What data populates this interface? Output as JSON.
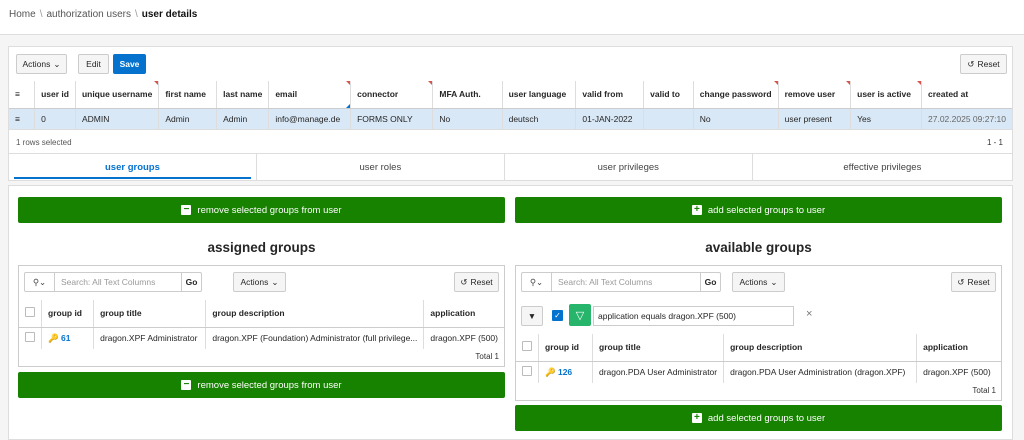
{
  "breadcrumb": {
    "home": "Home",
    "sep": "\\",
    "level2": "authorization users",
    "current": "user details"
  },
  "toolbar": {
    "actions": "Actions",
    "edit": "Edit",
    "save": "Save",
    "reset": "Reset"
  },
  "user_grid": {
    "columns": [
      "user id",
      "unique username",
      "first name",
      "last name",
      "email",
      "connector",
      "MFA Auth.",
      "user language",
      "valid from",
      "valid to",
      "change password",
      "remove user",
      "user is active",
      "created at"
    ],
    "row": [
      "0",
      "ADMIN",
      "Admin",
      "Admin",
      "info@manage.de",
      "FORMS ONLY",
      "No",
      "deutsch",
      "01-JAN-2022",
      "",
      "No",
      "user present",
      "Yes",
      "27.02.2025 09:27:10"
    ],
    "selected_text": "1 rows selected",
    "pagination": "1 - 1"
  },
  "tabs": [
    "user groups",
    "user roles",
    "user privileges",
    "effective privileges"
  ],
  "left": {
    "button": "remove selected groups from user",
    "title": "assigned groups",
    "search_placeholder": "Search: All Text Columns",
    "go": "Go",
    "actions": "Actions",
    "reset": "Reset",
    "columns": [
      "group id",
      "group title",
      "group description",
      "application"
    ],
    "row": {
      "id": "61",
      "title": "dragon.XPF Administrator",
      "desc": "dragon.XPF (Foundation) Administrator (full privilege...",
      "app": "dragon.XPF (500)"
    },
    "total": "Total 1"
  },
  "right": {
    "button": "add selected groups to user",
    "title": "available groups",
    "search_placeholder": "Search: All Text Columns",
    "go": "Go",
    "actions": "Actions",
    "reset": "Reset",
    "filter": "application equals dragon.XPF (500)",
    "columns": [
      "group id",
      "group title",
      "group description",
      "application"
    ],
    "row": {
      "id": "126",
      "title": "dragon.PDA User Administrator",
      "desc": "dragon.PDA User Administration (dragon.XPF)",
      "app": "dragon.XPF (500)"
    },
    "total": "Total 1"
  },
  "colors": {
    "accent": "#0572ce",
    "green": "#178200",
    "selected_row": "#d9e8f6"
  }
}
